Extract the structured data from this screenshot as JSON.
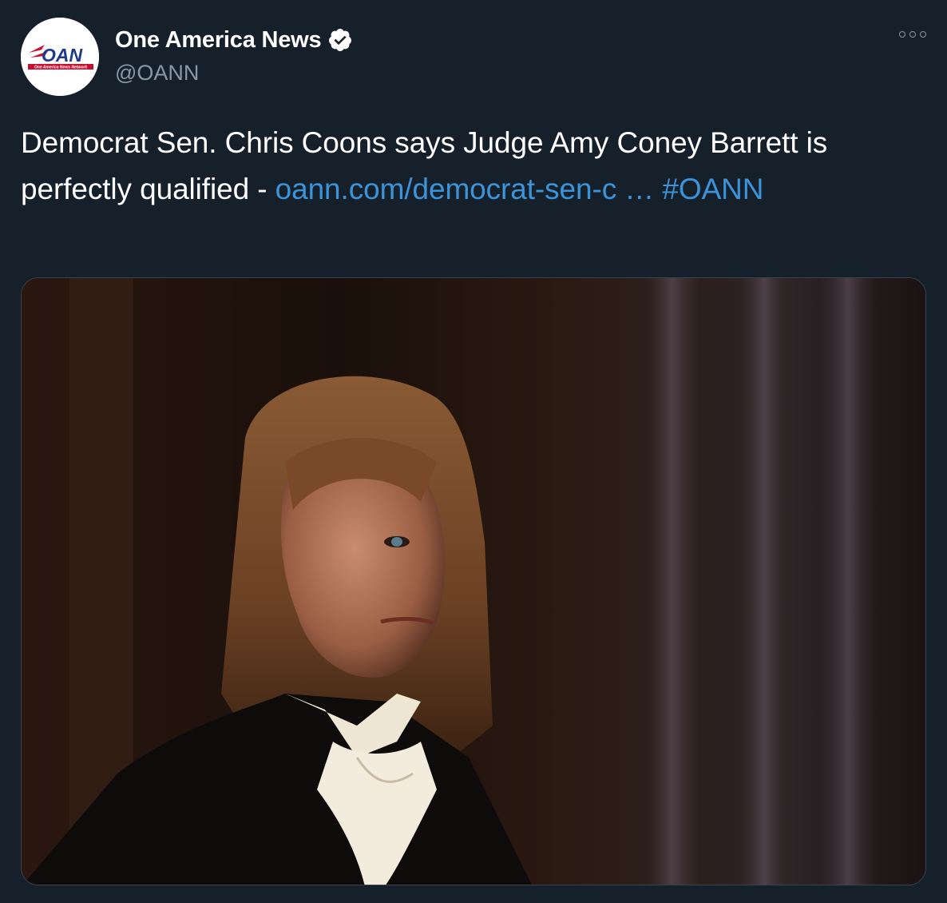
{
  "author": {
    "display_name": "One America News",
    "handle": "@OANN",
    "verified": true,
    "avatar_icon": "oan-logo",
    "avatar_logo_text": "OAN",
    "avatar_logo_subtext": "One America News Network"
  },
  "tweet": {
    "text": "Democrat Sen. Chris Coons says Judge Amy Coney Barrett is perfectly qualified - ",
    "link": "oann.com/democrat-sen-c …",
    "hashtag": "#OANN"
  },
  "media": {
    "type": "photo"
  },
  "colors": {
    "background": "#16202b",
    "link": "#3b94d9",
    "secondary_text": "#8899a6",
    "verified_badge": "#ffffff"
  },
  "icons": {
    "more": "more-options-icon",
    "verified": "verified-badge-icon"
  }
}
